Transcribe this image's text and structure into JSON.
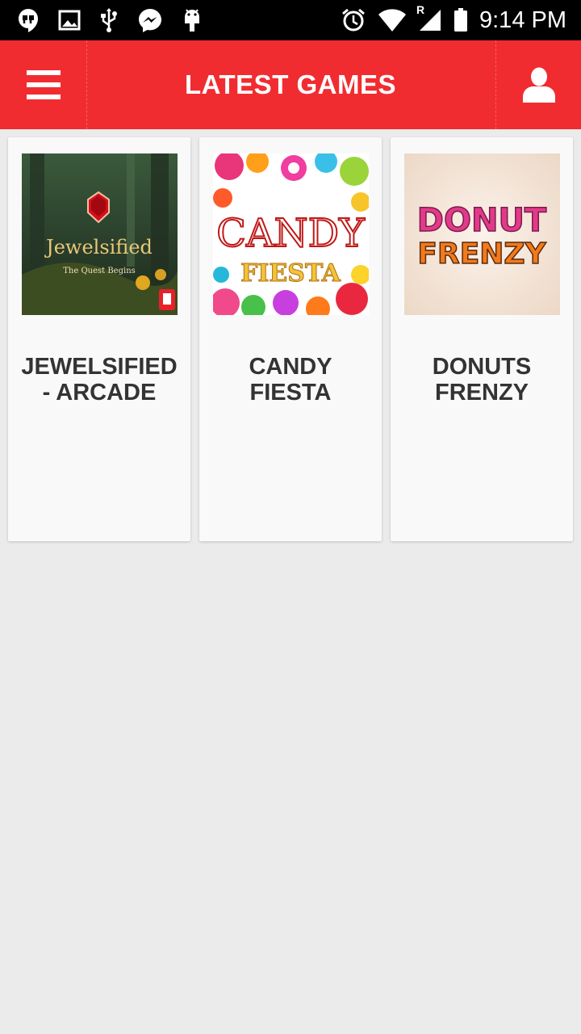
{
  "status_bar": {
    "time": "9:14 PM",
    "left_icons": [
      "hangouts-icon",
      "image-icon",
      "usb-icon",
      "messenger-icon",
      "android-icon"
    ],
    "right_icons": [
      "alarm-icon",
      "wifi-icon",
      "signal-roaming-icon",
      "battery-icon"
    ],
    "roaming_label": "R"
  },
  "app_bar": {
    "title": "LATEST GAMES",
    "background": "#f12c31"
  },
  "games": [
    {
      "title": "JEWELSIFIED - ARCADE",
      "thumb_title": "Jewelsified",
      "thumb_subtitle": "The Quest Begins"
    },
    {
      "title": "CANDY FIESTA",
      "thumb_line1": "CANDY",
      "thumb_line2": "FIESTA"
    },
    {
      "title": "DONUTS FRENZY",
      "thumb_line1": "DONUT",
      "thumb_line2": "FRENZY"
    }
  ]
}
